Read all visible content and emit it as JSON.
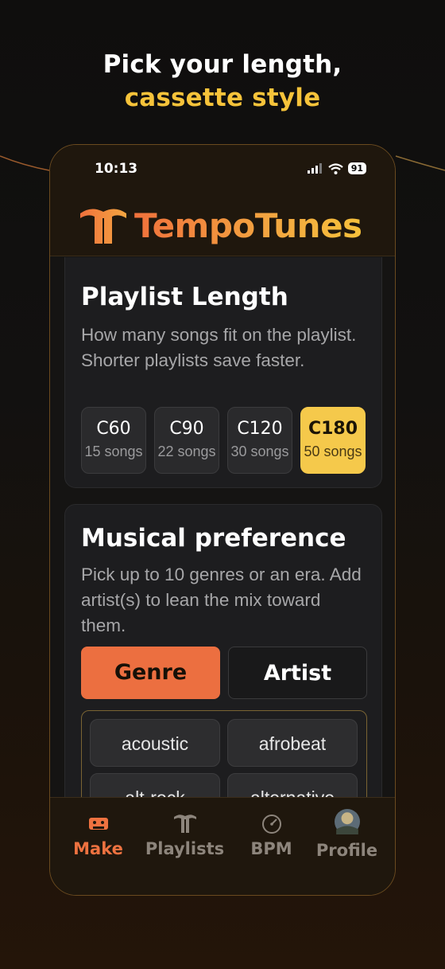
{
  "headline": {
    "line1": "Pick your length,",
    "line2": "cassette style"
  },
  "status_bar": {
    "time": "10:13",
    "battery": "91"
  },
  "app": {
    "name": "TempoTunes"
  },
  "playlist_length": {
    "title": "Playlist Length",
    "description": "How many songs fit on the playlist. Shorter playlists save faster.",
    "options": [
      {
        "code": "C60",
        "songs": "15 songs",
        "selected": false
      },
      {
        "code": "C90",
        "songs": "22 songs",
        "selected": false
      },
      {
        "code": "C120",
        "songs": "30 songs",
        "selected": false
      },
      {
        "code": "C180",
        "songs": "50 songs",
        "selected": true
      }
    ]
  },
  "musical_preference": {
    "title": "Musical preference",
    "description": "Pick up to 10 genres or an era. Add artist(s) to lean the mix toward them.",
    "tabs": [
      {
        "label": "Genre",
        "active": true
      },
      {
        "label": "Artist",
        "active": false
      }
    ],
    "genres": [
      "acoustic",
      "afrobeat",
      "alt-rock",
      "alternative"
    ]
  },
  "tab_bar": {
    "items": [
      {
        "label": "Make",
        "icon": "cassette-icon",
        "active": true
      },
      {
        "label": "Playlists",
        "icon": "tempotunes-logo-icon",
        "active": false
      },
      {
        "label": "BPM",
        "icon": "speedometer-icon",
        "active": false
      },
      {
        "label": "Profile",
        "icon": "avatar",
        "active": false
      }
    ]
  },
  "colors": {
    "accent_orange": "#ec6f40",
    "accent_yellow": "#f6c33a",
    "selected_length": "#f5c94b"
  }
}
